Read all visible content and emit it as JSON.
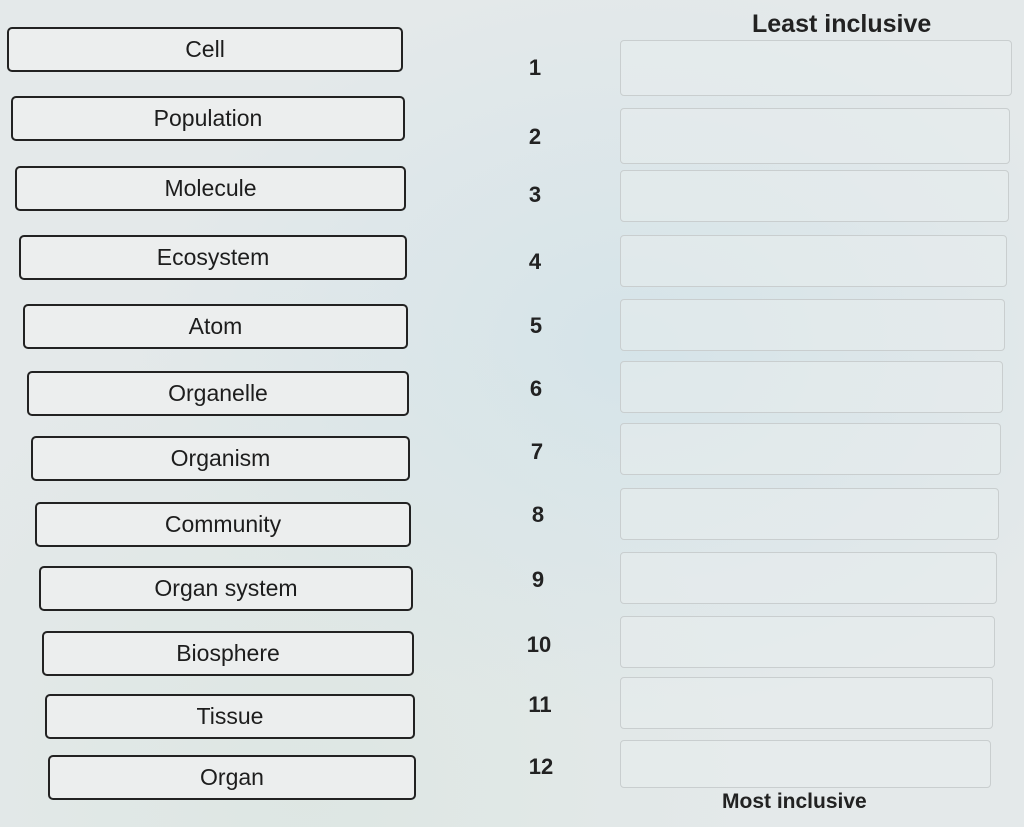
{
  "headers": {
    "least": "Least inclusive",
    "most": "Most inclusive"
  },
  "terms": [
    "Cell",
    "Population",
    "Molecule",
    "Ecosystem",
    "Atom",
    "Organelle",
    "Organism",
    "Community",
    "Organ system",
    "Biosphere",
    "Tissue",
    "Organ"
  ],
  "slot_numbers": [
    "1",
    "2",
    "3",
    "4",
    "5",
    "6",
    "7",
    "8",
    "9",
    "10",
    "11",
    "12"
  ]
}
